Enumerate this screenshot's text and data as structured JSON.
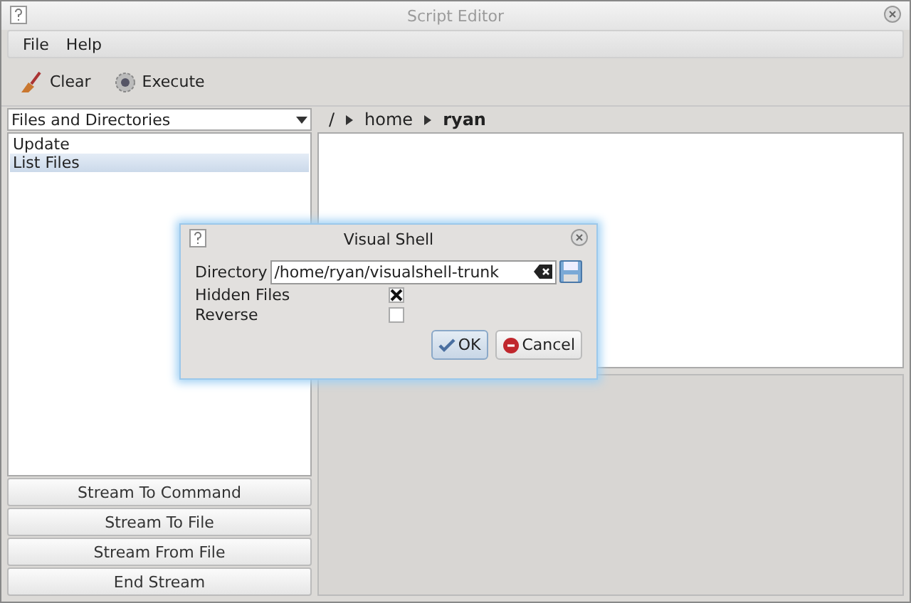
{
  "window": {
    "title": "Script Editor"
  },
  "menu": [
    "File",
    "Help"
  ],
  "toolbar": [
    {
      "kind": "clear",
      "label": "Clear"
    },
    {
      "kind": "execute",
      "label": "Execute"
    }
  ],
  "category_select": {
    "value": "Files and Directories"
  },
  "commands": [
    {
      "label": "Update",
      "selected": false
    },
    {
      "label": "List Files",
      "selected": true
    }
  ],
  "stream_buttons": [
    "Stream To Command",
    "Stream To File",
    "Stream From File",
    "End Stream"
  ],
  "breadcrumb": [
    {
      "label": "/",
      "selected": false
    },
    {
      "label": "home",
      "selected": false
    },
    {
      "label": "ryan",
      "selected": true
    }
  ],
  "dialog": {
    "title": "Visual Shell",
    "directory_label": "Directory",
    "directory_value": "/home/ryan/visualshell-trunk",
    "options": [
      {
        "label": "Hidden Files",
        "checked": true
      },
      {
        "label": "Reverse",
        "checked": false
      }
    ],
    "buttons": [
      {
        "kind": "ok",
        "label": "OK"
      },
      {
        "kind": "cancel",
        "label": "Cancel"
      }
    ]
  }
}
